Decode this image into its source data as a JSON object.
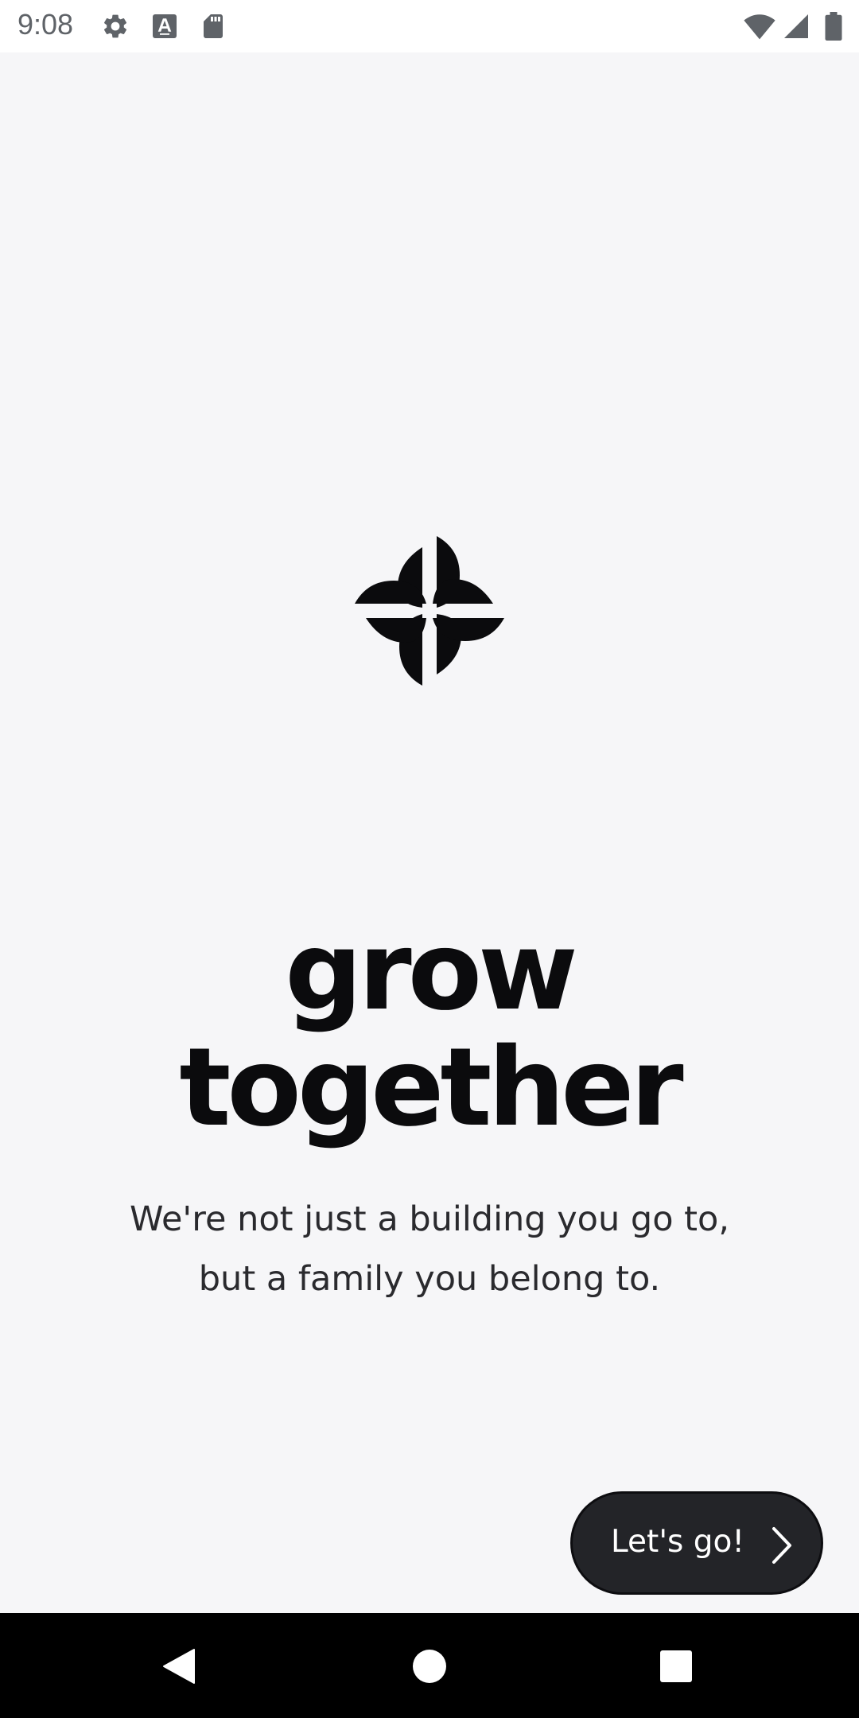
{
  "status_bar": {
    "time": "9:08",
    "left_icons": [
      "gear-icon",
      "font-a-icon",
      "sd-card-icon"
    ],
    "right_icons": [
      "wifi-icon",
      "cell-signal-icon",
      "battery-icon"
    ]
  },
  "hero": {
    "logo": "flower-logo",
    "headline_line1": "grow",
    "headline_line2": "together",
    "subtitle": "We're not just a building you go to, but a family you belong to."
  },
  "cta": {
    "label": "Let's go!",
    "icon": "chevron-right-icon",
    "color": "#232428"
  },
  "nav_bar": {
    "buttons": [
      "back-icon",
      "home-icon",
      "recents-icon"
    ]
  },
  "colors": {
    "background": "#f6f6f8",
    "text_primary": "#0b0b0d",
    "button": "#232428"
  }
}
